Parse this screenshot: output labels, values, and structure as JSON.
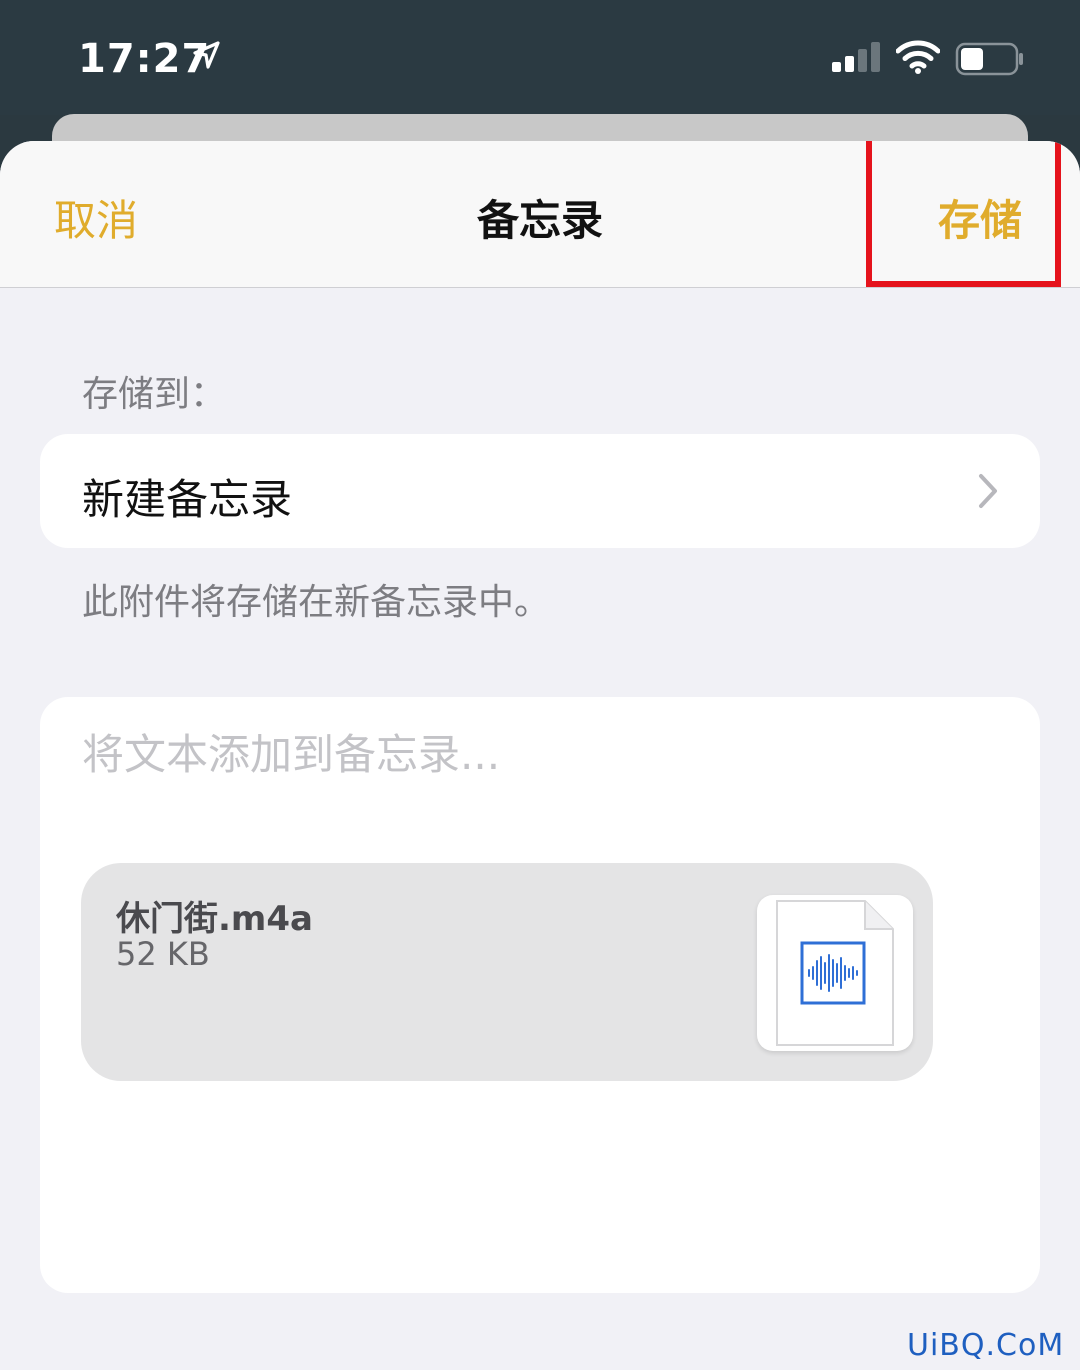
{
  "status_bar": {
    "time": "17:27"
  },
  "nav": {
    "cancel_label": "取消",
    "title": "备忘录",
    "save_label": "存储"
  },
  "save_to": {
    "label": "存储到：",
    "destination": "新建备忘录",
    "footer": "此附件将存储在新备忘录中。"
  },
  "note": {
    "placeholder": "将文本添加到备忘录...",
    "attachment": {
      "name": "休门街.m4a",
      "size": "52 KB"
    }
  },
  "watermark": "UiBQ.CoM",
  "colors": {
    "accent": "#e0ac2c",
    "highlight": "#e5131c",
    "audio_icon": "#2f6fd6"
  }
}
